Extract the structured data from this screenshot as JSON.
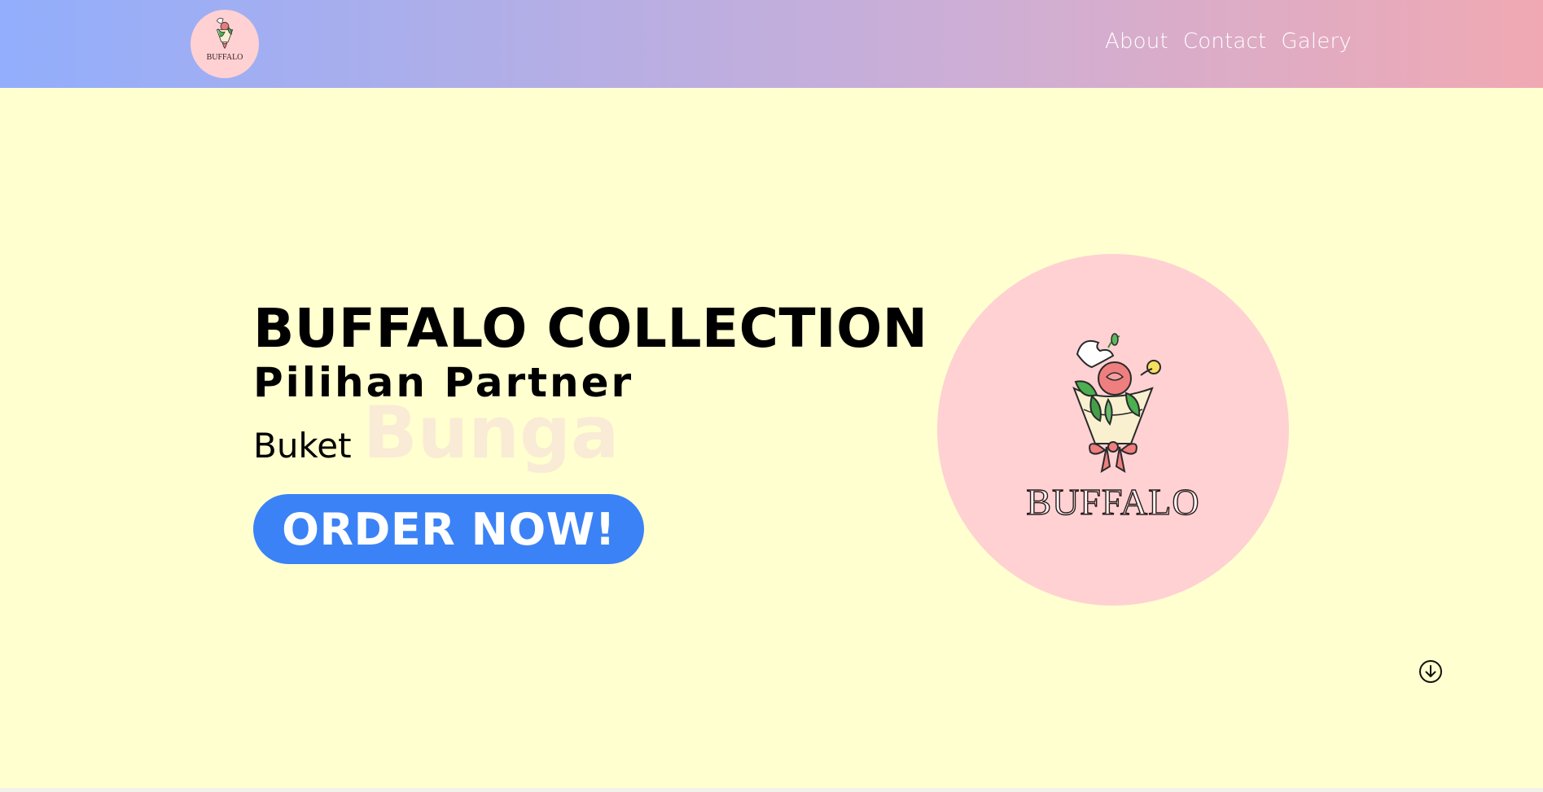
{
  "brand": {
    "logo_text": "BUFFALO",
    "bg_color": "#ffd1d3"
  },
  "nav": {
    "links": [
      {
        "label": "About"
      },
      {
        "label": "Contact"
      },
      {
        "label": "Galery"
      }
    ]
  },
  "hero": {
    "title": "BUFFALO COLLECTION",
    "subtitle": "Pilihan Partner",
    "line3_prefix": "Buket",
    "line3_highlight": "Bunga",
    "cta_label": "ORDER NOW!",
    "cta_color": "#3b82f6",
    "logo_text": "BUFFALO"
  },
  "colors": {
    "page_bg": "#ffffcf",
    "nav_gradient_start": "#92aefc",
    "nav_gradient_end": "#f0a9b3"
  },
  "icons": {
    "scroll": "arrow-down-circle-icon"
  }
}
